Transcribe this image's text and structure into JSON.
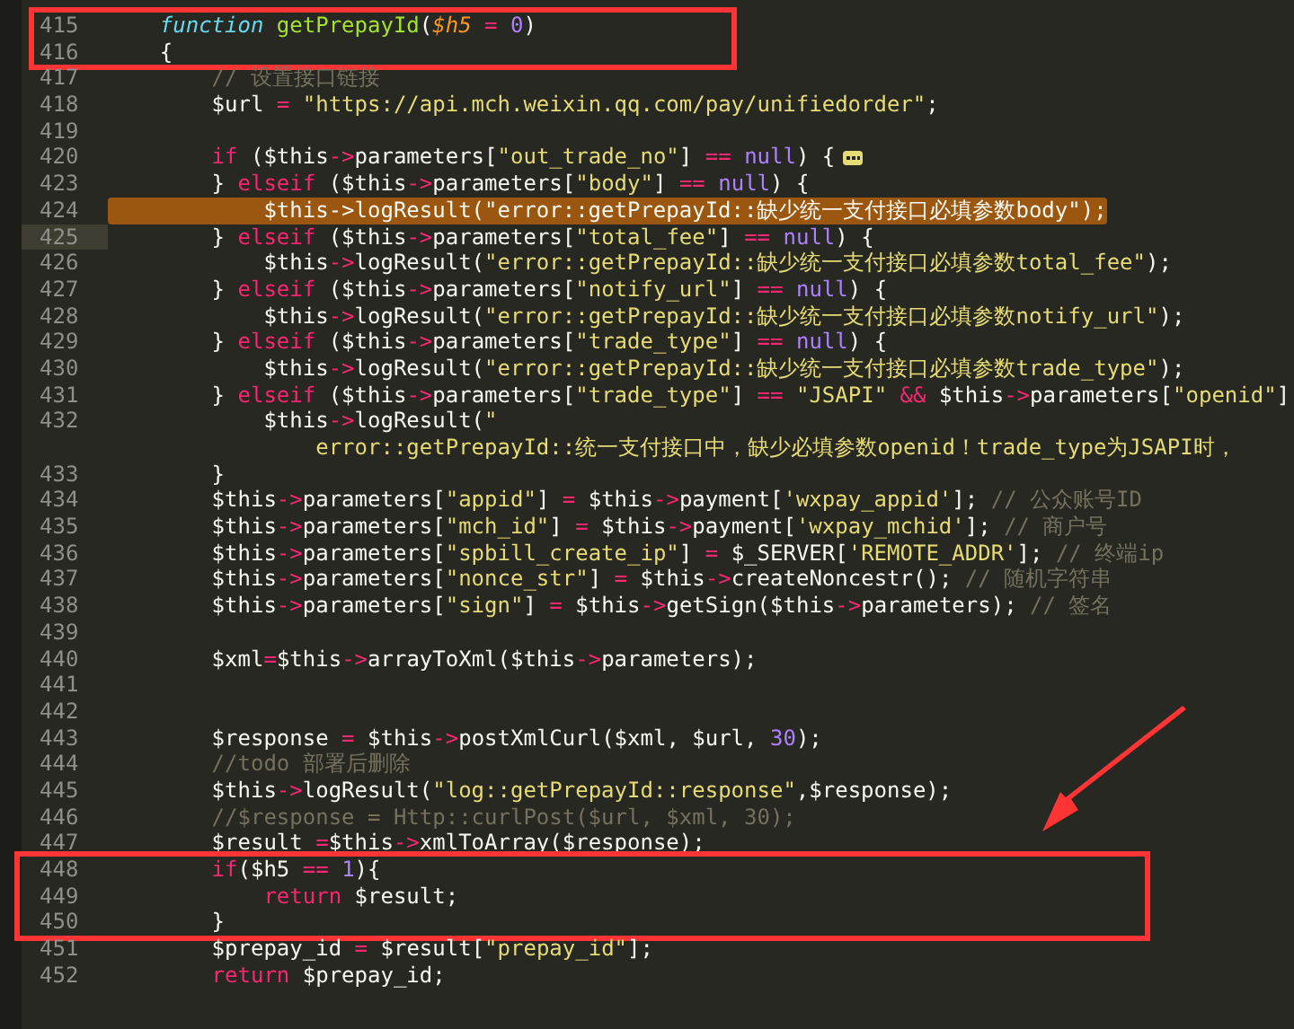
{
  "editor": {
    "sections": [
      {
        "kind": "boxed",
        "lines": [
          {
            "number": "415",
            "current": false,
            "highlighted": false,
            "folded": false,
            "tokens": [
              {
                "kind": "decl",
                "text": "    function "
              },
              {
                "kind": "name",
                "text": "getPrepayId"
              },
              {
                "kind": "plain",
                "text": "("
              },
              {
                "kind": "param",
                "text": "$h5"
              },
              {
                "kind": "op",
                "text": " = "
              },
              {
                "kind": "num",
                "text": "0"
              },
              {
                "kind": "plain",
                "text": ")"
              }
            ]
          },
          {
            "number": "416",
            "current": false,
            "highlighted": false,
            "folded": false,
            "tokens": [
              {
                "kind": "plain",
                "text": "    {"
              }
            ]
          }
        ]
      },
      {
        "kind": "plain",
        "lines": [
          {
            "number": "417",
            "current": false,
            "highlighted": false,
            "folded": false,
            "tokens": [
              {
                "kind": "comment",
                "text": "        // 设置接口链接"
              }
            ]
          },
          {
            "number": "418",
            "current": false,
            "highlighted": false,
            "folded": false,
            "tokens": [
              {
                "kind": "plain",
                "text": "        $url "
              },
              {
                "kind": "op",
                "text": "= "
              },
              {
                "kind": "str",
                "text": "\"https://api.mch.weixin.qq.com/pay/unifiedorder\""
              },
              {
                "kind": "plain",
                "text": ";"
              }
            ]
          },
          {
            "number": "419",
            "current": false,
            "highlighted": false,
            "folded": false
          },
          {
            "number": "420",
            "current": false,
            "highlighted": false,
            "folded": true,
            "tokens": [
              {
                "kind": "op",
                "text": "        if"
              },
              {
                "kind": "plain",
                "text": " ($this"
              },
              {
                "kind": "op",
                "text": "->"
              },
              {
                "kind": "plain",
                "text": "parameters["
              },
              {
                "kind": "str",
                "text": "\"out_trade_no\""
              },
              {
                "kind": "plain",
                "text": "] "
              },
              {
                "kind": "op",
                "text": "== "
              },
              {
                "kind": "num",
                "text": "null"
              },
              {
                "kind": "plain",
                "text": ") {"
              }
            ]
          },
          {
            "number": "423",
            "current": false,
            "highlighted": false,
            "folded": false,
            "tokens": [
              {
                "kind": "plain",
                "text": "        } "
              },
              {
                "kind": "op",
                "text": "elseif"
              },
              {
                "kind": "plain",
                "text": " ($this"
              },
              {
                "kind": "op",
                "text": "->"
              },
              {
                "kind": "plain",
                "text": "parameters["
              },
              {
                "kind": "str",
                "text": "\"body\""
              },
              {
                "kind": "plain",
                "text": "] "
              },
              {
                "kind": "op",
                "text": "== "
              },
              {
                "kind": "num",
                "text": "null"
              },
              {
                "kind": "plain",
                "text": ") {"
              }
            ]
          },
          {
            "number": "424",
            "current": false,
            "highlighted": true,
            "folded": false,
            "tokens": [
              {
                "kind": "plain",
                "text": "            $this->logResult(\"error::getPrepayId::缺少统一支付接口必填参数body\");"
              }
            ]
          },
          {
            "number": "425",
            "current": true,
            "highlighted": false,
            "folded": false,
            "tokens": [
              {
                "kind": "plain",
                "text": "        } "
              },
              {
                "kind": "op",
                "text": "elseif"
              },
              {
                "kind": "plain",
                "text": " ($this"
              },
              {
                "kind": "op",
                "text": "->"
              },
              {
                "kind": "plain",
                "text": "parameters["
              },
              {
                "kind": "str",
                "text": "\"total_fee\""
              },
              {
                "kind": "plain",
                "text": "] "
              },
              {
                "kind": "op",
                "text": "== "
              },
              {
                "kind": "num",
                "text": "null"
              },
              {
                "kind": "plain",
                "text": ") {"
              }
            ]
          },
          {
            "number": "426",
            "current": false,
            "highlighted": false,
            "folded": false,
            "tokens": [
              {
                "kind": "plain",
                "text": "            $this"
              },
              {
                "kind": "op",
                "text": "->"
              },
              {
                "kind": "plain",
                "text": "logResult("
              },
              {
                "kind": "str",
                "text": "\"error::getPrepayId::缺少统一支付接口必填参数total_fee\""
              },
              {
                "kind": "plain",
                "text": ");"
              }
            ]
          },
          {
            "number": "427",
            "current": false,
            "highlighted": false,
            "folded": false,
            "tokens": [
              {
                "kind": "plain",
                "text": "        } "
              },
              {
                "kind": "op",
                "text": "elseif"
              },
              {
                "kind": "plain",
                "text": " ($this"
              },
              {
                "kind": "op",
                "text": "->"
              },
              {
                "kind": "plain",
                "text": "parameters["
              },
              {
                "kind": "str",
                "text": "\"notify_url\""
              },
              {
                "kind": "plain",
                "text": "] "
              },
              {
                "kind": "op",
                "text": "== "
              },
              {
                "kind": "num",
                "text": "null"
              },
              {
                "kind": "plain",
                "text": ") {"
              }
            ]
          },
          {
            "number": "428",
            "current": false,
            "highlighted": false,
            "folded": false,
            "tokens": [
              {
                "kind": "plain",
                "text": "            $this"
              },
              {
                "kind": "op",
                "text": "->"
              },
              {
                "kind": "plain",
                "text": "logResult("
              },
              {
                "kind": "str",
                "text": "\"error::getPrepayId::缺少统一支付接口必填参数notify_url\""
              },
              {
                "kind": "plain",
                "text": ");"
              }
            ]
          },
          {
            "number": "429",
            "current": false,
            "highlighted": false,
            "folded": false,
            "tokens": [
              {
                "kind": "plain",
                "text": "        } "
              },
              {
                "kind": "op",
                "text": "elseif"
              },
              {
                "kind": "plain",
                "text": " ($this"
              },
              {
                "kind": "op",
                "text": "->"
              },
              {
                "kind": "plain",
                "text": "parameters["
              },
              {
                "kind": "str",
                "text": "\"trade_type\""
              },
              {
                "kind": "plain",
                "text": "] "
              },
              {
                "kind": "op",
                "text": "== "
              },
              {
                "kind": "num",
                "text": "null"
              },
              {
                "kind": "plain",
                "text": ") {"
              }
            ]
          },
          {
            "number": "430",
            "current": false,
            "highlighted": false,
            "folded": false,
            "tokens": [
              {
                "kind": "plain",
                "text": "            $this"
              },
              {
                "kind": "op",
                "text": "->"
              },
              {
                "kind": "plain",
                "text": "logResult("
              },
              {
                "kind": "str",
                "text": "\"error::getPrepayId::缺少统一支付接口必填参数trade_type\""
              },
              {
                "kind": "plain",
                "text": ");"
              }
            ]
          },
          {
            "number": "431",
            "current": false,
            "highlighted": false,
            "folded": false,
            "tokens": [
              {
                "kind": "plain",
                "text": "        } "
              },
              {
                "kind": "op",
                "text": "elseif"
              },
              {
                "kind": "plain",
                "text": " ($this"
              },
              {
                "kind": "op",
                "text": "->"
              },
              {
                "kind": "plain",
                "text": "parameters["
              },
              {
                "kind": "str",
                "text": "\"trade_type\""
              },
              {
                "kind": "plain",
                "text": "] "
              },
              {
                "kind": "op",
                "text": "== "
              },
              {
                "kind": "str",
                "text": "\"JSAPI\" "
              },
              {
                "kind": "op",
                "text": "&&"
              },
              {
                "kind": "plain",
                "text": " $this"
              },
              {
                "kind": "op",
                "text": "->"
              },
              {
                "kind": "plain",
                "text": "parameters["
              },
              {
                "kind": "str",
                "text": "\"openid\""
              },
              {
                "kind": "plain",
                "text": "]"
              }
            ]
          },
          {
            "number": "432",
            "current": false,
            "highlighted": false,
            "folded": false,
            "tokens": [
              {
                "kind": "plain",
                "text": "            $this"
              },
              {
                "kind": "op",
                "text": "->"
              },
              {
                "kind": "plain",
                "text": "logResult("
              },
              {
                "kind": "str",
                "text": "\""
              }
            ]
          },
          {
            "current": false,
            "highlighted": false,
            "folded": false,
            "tokens": [
              {
                "kind": "str",
                "text": "                error::getPrepayId::统一支付接口中，缺少必填参数openid！trade_type为JSAPI时，"
              }
            ]
          },
          {
            "number": "433",
            "current": false,
            "highlighted": false,
            "folded": false,
            "tokens": [
              {
                "kind": "plain",
                "text": "        }"
              }
            ]
          },
          {
            "number": "434",
            "current": false,
            "highlighted": false,
            "folded": false,
            "tokens": [
              {
                "kind": "plain",
                "text": "        $this"
              },
              {
                "kind": "op",
                "text": "->"
              },
              {
                "kind": "plain",
                "text": "parameters["
              },
              {
                "kind": "str",
                "text": "\"appid\""
              },
              {
                "kind": "plain",
                "text": "] "
              },
              {
                "kind": "op",
                "text": "="
              },
              {
                "kind": "plain",
                "text": " $this"
              },
              {
                "kind": "op",
                "text": "->"
              },
              {
                "kind": "plain",
                "text": "payment["
              },
              {
                "kind": "str",
                "text": "'wxpay_appid'"
              },
              {
                "kind": "plain",
                "text": "]; "
              },
              {
                "kind": "comment",
                "text": "// 公众账号ID"
              }
            ]
          },
          {
            "number": "435",
            "current": false,
            "highlighted": false,
            "folded": false,
            "tokens": [
              {
                "kind": "plain",
                "text": "        $this"
              },
              {
                "kind": "op",
                "text": "->"
              },
              {
                "kind": "plain",
                "text": "parameters["
              },
              {
                "kind": "str",
                "text": "\"mch_id\""
              },
              {
                "kind": "plain",
                "text": "] "
              },
              {
                "kind": "op",
                "text": "="
              },
              {
                "kind": "plain",
                "text": " $this"
              },
              {
                "kind": "op",
                "text": "->"
              },
              {
                "kind": "plain",
                "text": "payment["
              },
              {
                "kind": "str",
                "text": "'wxpay_mchid'"
              },
              {
                "kind": "plain",
                "text": "]; "
              },
              {
                "kind": "comment",
                "text": "// 商户号"
              }
            ]
          },
          {
            "number": "436",
            "current": false,
            "highlighted": false,
            "folded": false,
            "tokens": [
              {
                "kind": "plain",
                "text": "        $this"
              },
              {
                "kind": "op",
                "text": "->"
              },
              {
                "kind": "plain",
                "text": "parameters["
              },
              {
                "kind": "str",
                "text": "\"spbill_create_ip\""
              },
              {
                "kind": "plain",
                "text": "] "
              },
              {
                "kind": "op",
                "text": "="
              },
              {
                "kind": "plain",
                "text": " $_SERVER["
              },
              {
                "kind": "str",
                "text": "'REMOTE_ADDR'"
              },
              {
                "kind": "plain",
                "text": "]; "
              },
              {
                "kind": "comment",
                "text": "// 终端ip"
              }
            ]
          },
          {
            "number": "437",
            "current": false,
            "highlighted": false,
            "folded": false,
            "tokens": [
              {
                "kind": "plain",
                "text": "        $this"
              },
              {
                "kind": "op",
                "text": "->"
              },
              {
                "kind": "plain",
                "text": "parameters["
              },
              {
                "kind": "str",
                "text": "\"nonce_str\""
              },
              {
                "kind": "plain",
                "text": "] "
              },
              {
                "kind": "op",
                "text": "="
              },
              {
                "kind": "plain",
                "text": " $this"
              },
              {
                "kind": "op",
                "text": "->"
              },
              {
                "kind": "plain",
                "text": "createNoncestr(); "
              },
              {
                "kind": "comment",
                "text": "// 随机字符串"
              }
            ]
          },
          {
            "number": "438",
            "current": false,
            "highlighted": false,
            "folded": false,
            "tokens": [
              {
                "kind": "plain",
                "text": "        $this"
              },
              {
                "kind": "op",
                "text": "->"
              },
              {
                "kind": "plain",
                "text": "parameters["
              },
              {
                "kind": "str",
                "text": "\"sign\""
              },
              {
                "kind": "plain",
                "text": "] "
              },
              {
                "kind": "op",
                "text": "="
              },
              {
                "kind": "plain",
                "text": " $this"
              },
              {
                "kind": "op",
                "text": "->"
              },
              {
                "kind": "plain",
                "text": "getSign($this"
              },
              {
                "kind": "op",
                "text": "->"
              },
              {
                "kind": "plain",
                "text": "parameters); "
              },
              {
                "kind": "comment",
                "text": "// 签名"
              }
            ]
          },
          {
            "number": "439",
            "current": false,
            "highlighted": false,
            "folded": false
          },
          {
            "number": "440",
            "current": false,
            "highlighted": false,
            "folded": false,
            "tokens": [
              {
                "kind": "plain",
                "text": "        $xml"
              },
              {
                "kind": "op",
                "text": "="
              },
              {
                "kind": "plain",
                "text": "$this"
              },
              {
                "kind": "op",
                "text": "->"
              },
              {
                "kind": "plain",
                "text": "arrayToXml($this"
              },
              {
                "kind": "op",
                "text": "->"
              },
              {
                "kind": "plain",
                "text": "parameters);"
              }
            ]
          },
          {
            "number": "441",
            "current": false,
            "highlighted": false,
            "folded": false
          },
          {
            "number": "442",
            "current": false,
            "highlighted": false,
            "folded": false
          },
          {
            "number": "443",
            "current": false,
            "highlighted": false,
            "folded": false,
            "tokens": [
              {
                "kind": "plain",
                "text": "        $response "
              },
              {
                "kind": "op",
                "text": "="
              },
              {
                "kind": "plain",
                "text": " $this"
              },
              {
                "kind": "op",
                "text": "->"
              },
              {
                "kind": "plain",
                "text": "postXmlCurl($xml, $url, "
              },
              {
                "kind": "num",
                "text": "30"
              },
              {
                "kind": "plain",
                "text": ");"
              }
            ]
          },
          {
            "number": "444",
            "current": false,
            "highlighted": false,
            "folded": false,
            "tokens": [
              {
                "kind": "comment",
                "text": "        //todo 部署后删除"
              }
            ]
          },
          {
            "number": "445",
            "current": false,
            "highlighted": false,
            "folded": false,
            "tokens": [
              {
                "kind": "plain",
                "text": "        $this"
              },
              {
                "kind": "op",
                "text": "->"
              },
              {
                "kind": "plain",
                "text": "logResult("
              },
              {
                "kind": "str",
                "text": "\"log::getPrepayId::response\""
              },
              {
                "kind": "plain",
                "text": ",$response);"
              }
            ]
          },
          {
            "number": "446",
            "current": false,
            "highlighted": false,
            "folded": false,
            "tokens": [
              {
                "kind": "comment",
                "text": "        //$response = Http::curlPost($url, $xml, 30);"
              }
            ]
          },
          {
            "number": "447",
            "current": false,
            "highlighted": false,
            "folded": false,
            "tokens": [
              {
                "kind": "plain",
                "text": "        $result "
              },
              {
                "kind": "op",
                "text": "="
              },
              {
                "kind": "plain",
                "text": "$this"
              },
              {
                "kind": "op",
                "text": "->"
              },
              {
                "kind": "plain",
                "text": "xmlToArray($response);"
              }
            ]
          }
        ]
      },
      {
        "kind": "boxed-arrow",
        "lines": [
          {
            "number": "448",
            "current": false,
            "highlighted": false,
            "folded": false,
            "tokens": [
              {
                "kind": "op",
                "text": "        if"
              },
              {
                "kind": "plain",
                "text": "($h5 "
              },
              {
                "kind": "op",
                "text": "== "
              },
              {
                "kind": "num",
                "text": "1"
              },
              {
                "kind": "plain",
                "text": "){"
              }
            ]
          },
          {
            "number": "449",
            "current": false,
            "highlighted": false,
            "folded": false,
            "tokens": [
              {
                "kind": "op",
                "text": "            return"
              },
              {
                "kind": "plain",
                "text": " $result;"
              }
            ]
          },
          {
            "number": "450",
            "current": false,
            "highlighted": false,
            "folded": false,
            "tokens": [
              {
                "kind": "plain",
                "text": "        }"
              }
            ]
          }
        ]
      },
      {
        "kind": "plain",
        "lines": [
          {
            "number": "451",
            "current": false,
            "highlighted": false,
            "folded": false,
            "tokens": [
              {
                "kind": "plain",
                "text": "        $prepay_id "
              },
              {
                "kind": "op",
                "text": "="
              },
              {
                "kind": "plain",
                "text": " $result["
              },
              {
                "kind": "str",
                "text": "\"prepay_id\""
              },
              {
                "kind": "plain",
                "text": "];"
              }
            ]
          },
          {
            "number": "452",
            "current": false,
            "highlighted": false,
            "folded": false,
            "tokens": [
              {
                "kind": "op",
                "text": "        return"
              },
              {
                "kind": "plain",
                "text": " $prepay_id;"
              }
            ]
          }
        ]
      }
    ]
  }
}
